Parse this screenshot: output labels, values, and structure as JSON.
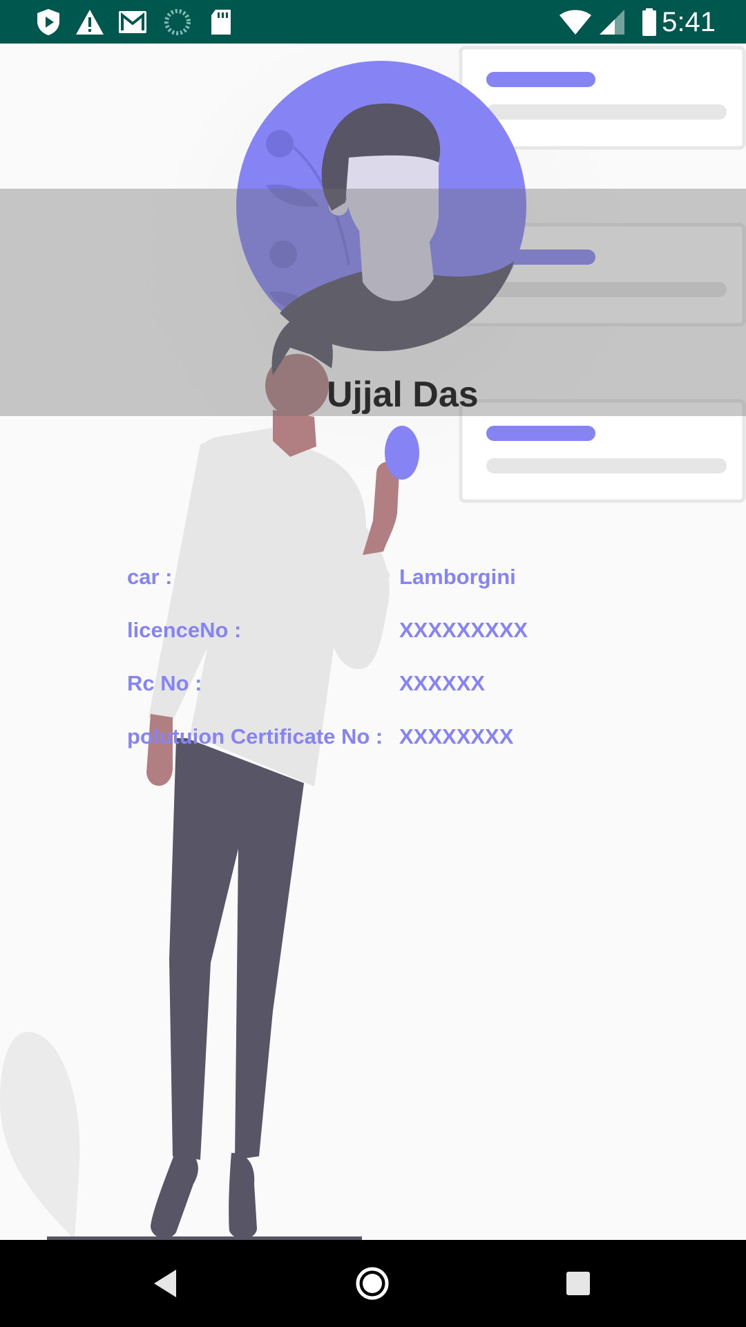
{
  "status_bar": {
    "time": "5:41",
    "left_icons": [
      "shield-play-icon",
      "warning-icon",
      "gmail-icon",
      "sync-progress-icon",
      "sd-card-icon"
    ],
    "right_icons": [
      "wifi-icon",
      "cell-signal-icon",
      "battery-icon"
    ]
  },
  "profile": {
    "name": "Ujjal Das"
  },
  "details": [
    {
      "label": "car :",
      "value": "Lamborgini"
    },
    {
      "label": "licenceNo :",
      "value": "XXXXXXXXX"
    },
    {
      "label": "Rc No :",
      "value": "XXXXXX"
    },
    {
      "label": "polutuion Certificate No :",
      "value": "XXXXXXXX"
    }
  ],
  "colors": {
    "status_bar": "#00574e",
    "accent": "#8683f4",
    "name_text": "#2b2b2b",
    "nav_bar": "#000000"
  },
  "nav_bar": {
    "buttons": [
      "back-icon",
      "home-icon",
      "recents-icon"
    ]
  }
}
